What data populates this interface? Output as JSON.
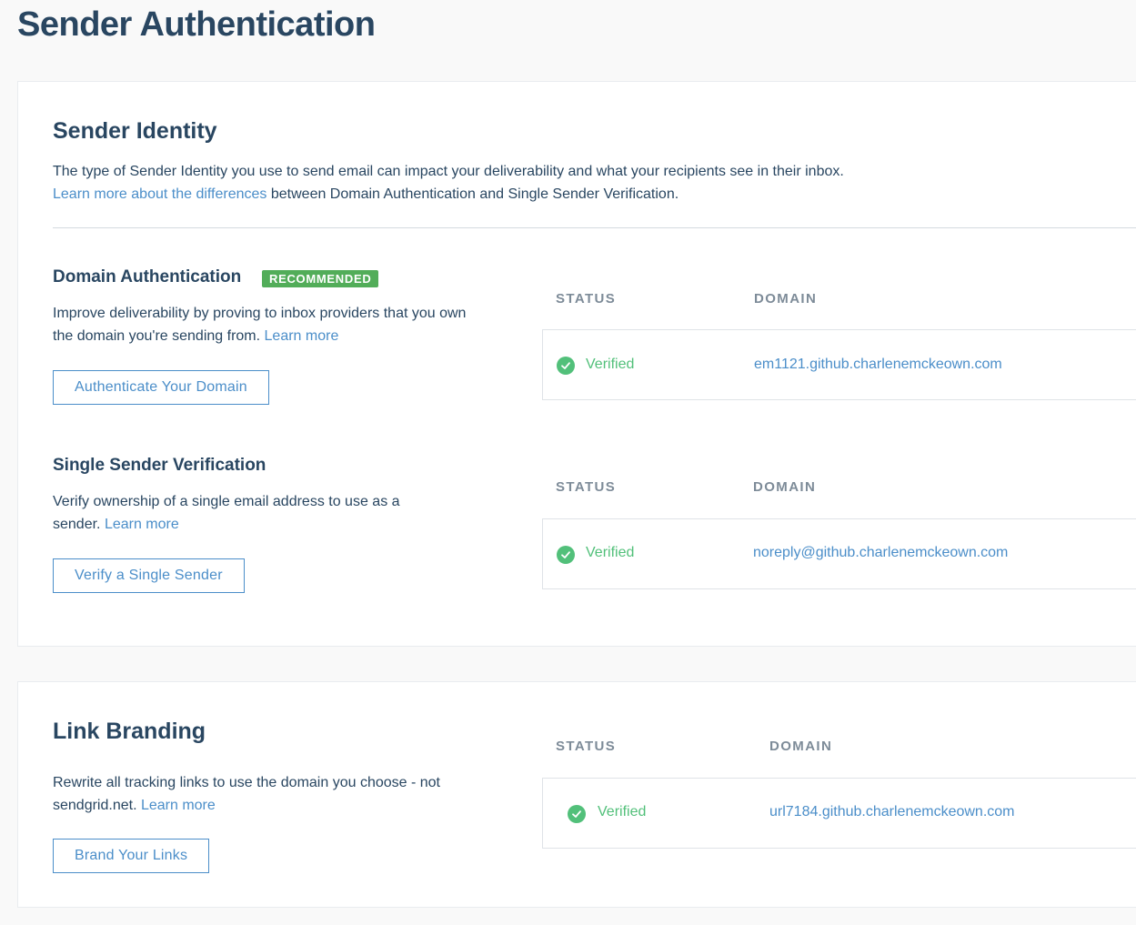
{
  "page": {
    "title": "Sender Authentication"
  },
  "identity": {
    "title": "Sender Identity",
    "intro_line1": "The type of Sender Identity you use to send email can impact your deliverability and what your recipients see in their inbox.",
    "intro_link": "Learn more about the differences",
    "intro_line2_rest": " between Domain Authentication and Single Sender Verification."
  },
  "domain_auth": {
    "title": "Domain Authentication",
    "badge": "RECOMMENDED",
    "desc": "Improve deliverability by proving to inbox providers that you own the domain you're sending from. ",
    "learn_more": "Learn more",
    "button": "Authenticate Your Domain",
    "status_label": "STATUS",
    "domain_label": "DOMAIN",
    "status": "Verified",
    "domain": "em1121.github.charlenemckeown.com"
  },
  "single_sender": {
    "title": "Single Sender Verification",
    "desc": "Verify ownership of a single email address to use as a sender. ",
    "learn_more": "Learn more",
    "button": "Verify a Single Sender",
    "status_label": "STATUS",
    "domain_label": "DOMAIN",
    "status": "Verified",
    "domain": "noreply@github.charlenemckeown.com"
  },
  "link_branding": {
    "title": "Link Branding",
    "desc": "Rewrite all tracking links to use the domain you choose - not sendgrid.net. ",
    "learn_more": "Learn more",
    "button": "Brand Your Links",
    "status_label": "STATUS",
    "domain_label": "DOMAIN",
    "status": "Verified",
    "domain": "url7184.github.charlenemckeown.com"
  },
  "icons": {
    "verified": "check-circle-icon"
  },
  "colors": {
    "accent": "#4b8ec9",
    "success": "#52c07a",
    "badge": "#52ad59",
    "heading": "#294661"
  }
}
